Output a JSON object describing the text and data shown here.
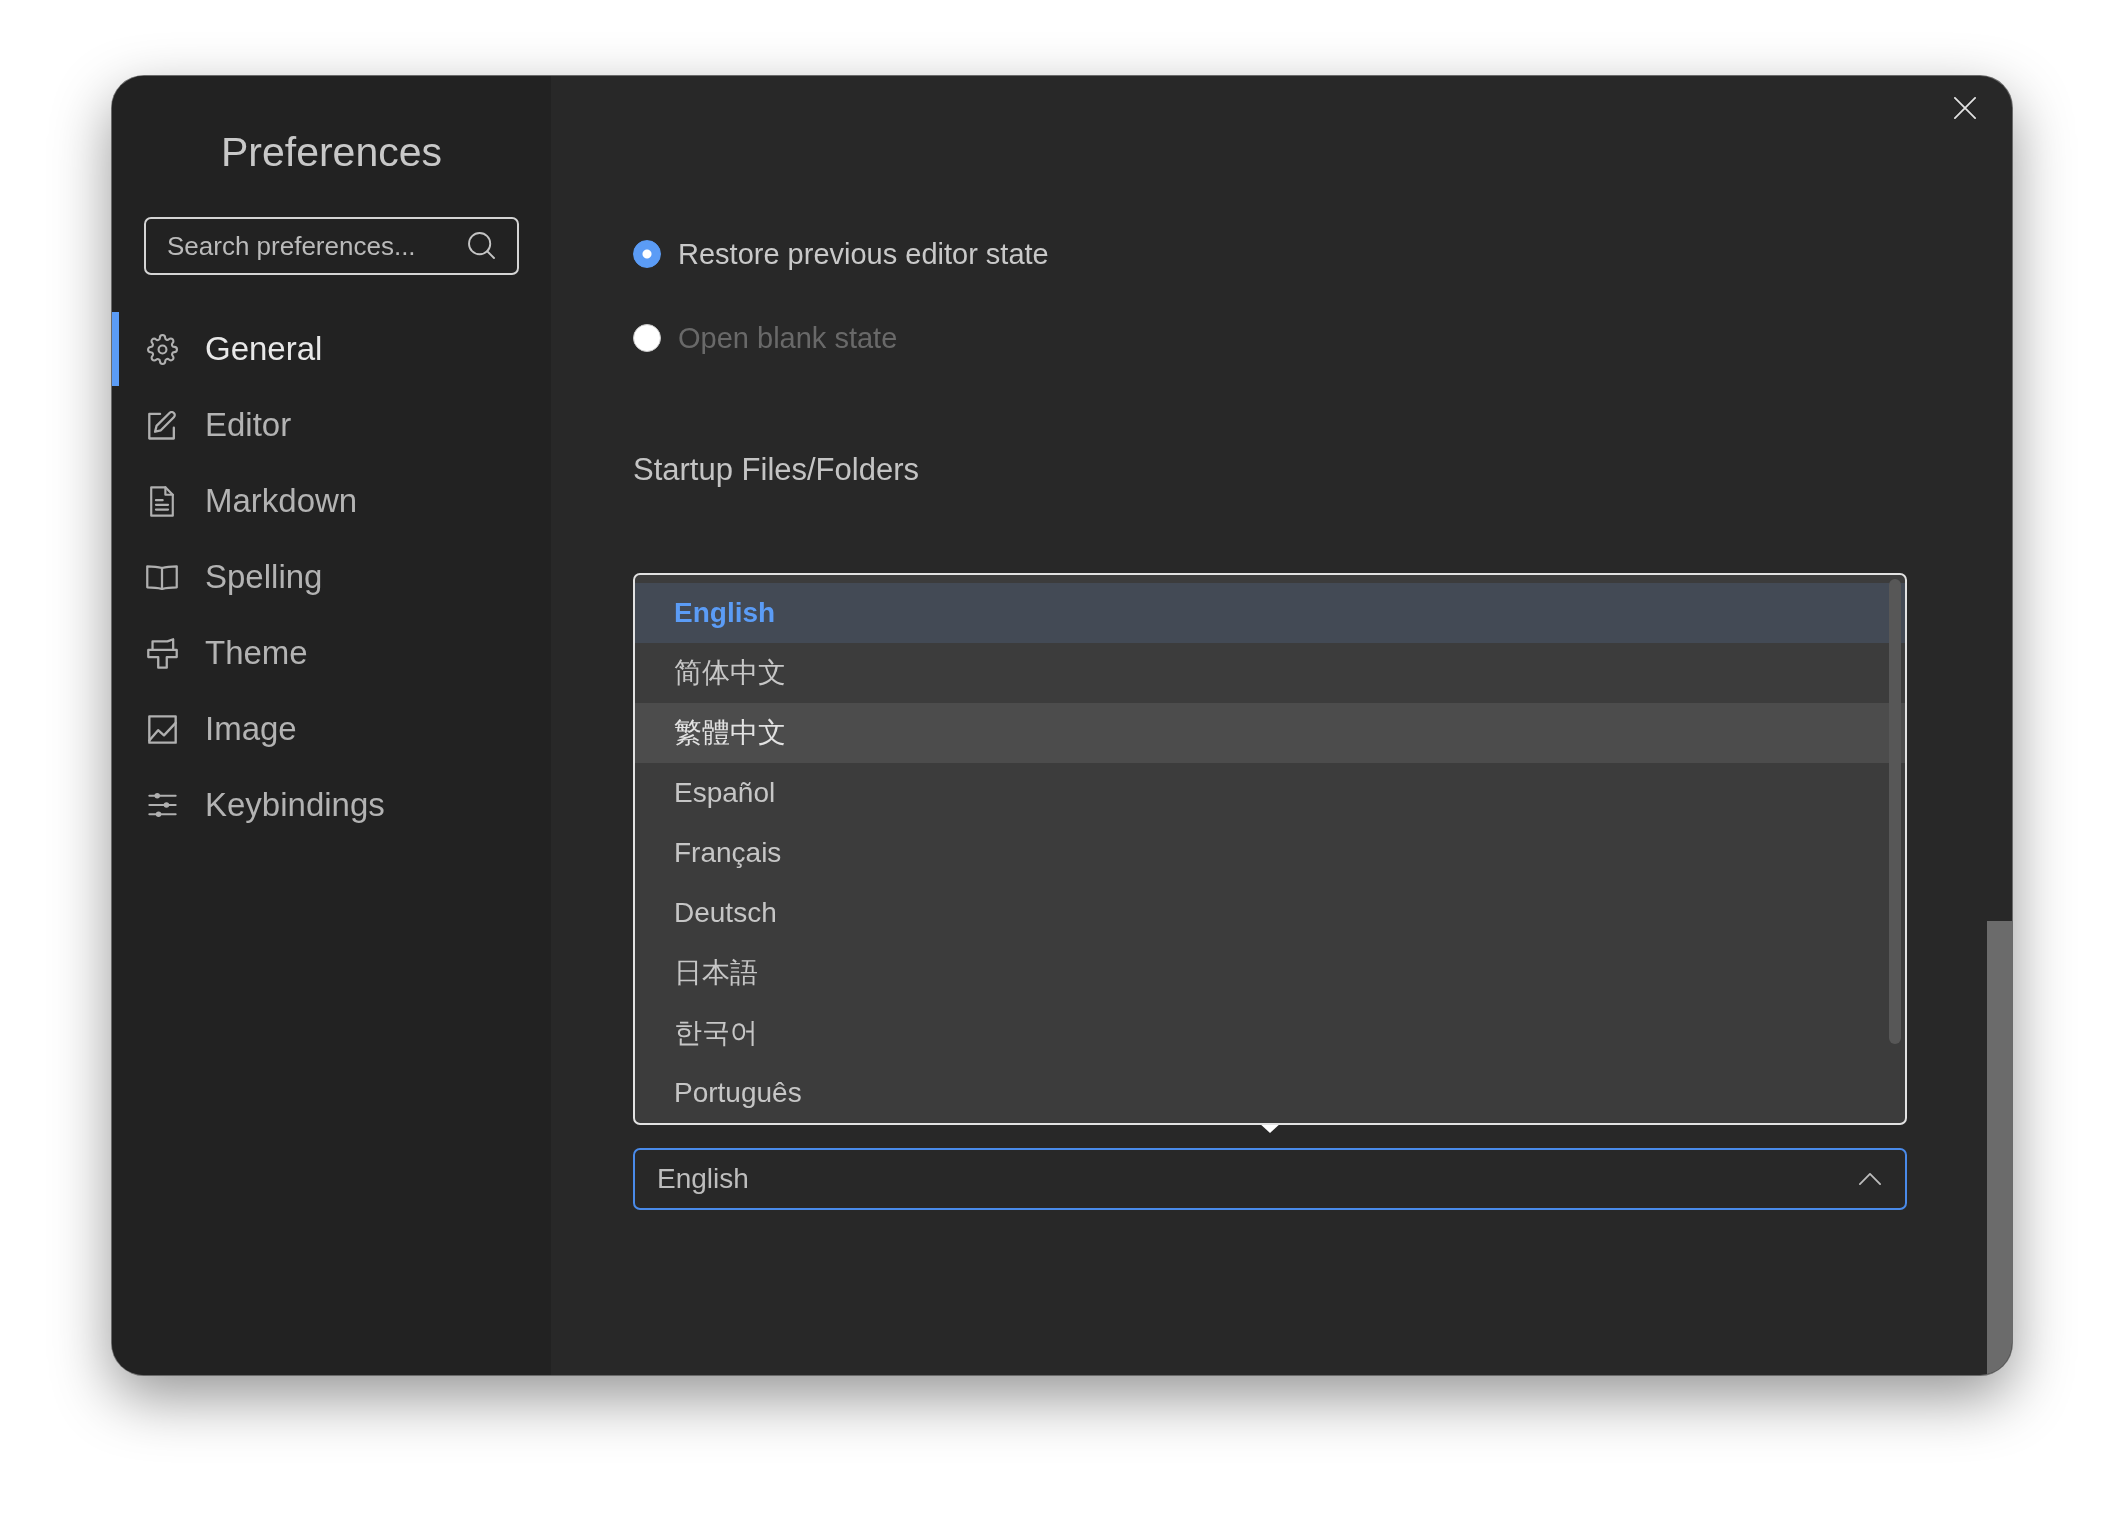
{
  "sidebar": {
    "title": "Preferences",
    "search": {
      "placeholder": "Search preferences..."
    },
    "items": [
      {
        "label": "General",
        "selected": true
      },
      {
        "label": "Editor",
        "selected": false
      },
      {
        "label": "Markdown",
        "selected": false
      },
      {
        "label": "Spelling",
        "selected": false
      },
      {
        "label": "Theme",
        "selected": false
      },
      {
        "label": "Image",
        "selected": false
      },
      {
        "label": "Keybindings",
        "selected": false
      }
    ]
  },
  "startup": {
    "options": [
      {
        "label": "Restore previous editor state",
        "selected": true
      },
      {
        "label": "Open blank state",
        "selected": false
      }
    ]
  },
  "startup_files": {
    "title": "Startup Files/Folders"
  },
  "language": {
    "expanded": true,
    "options": [
      {
        "label": "English",
        "selected": true,
        "hovered": false
      },
      {
        "label": "简体中文",
        "selected": false,
        "hovered": false
      },
      {
        "label": "繁體中文",
        "selected": false,
        "hovered": true
      },
      {
        "label": "Español",
        "selected": false,
        "hovered": false
      },
      {
        "label": "Français",
        "selected": false,
        "hovered": false
      },
      {
        "label": "Deutsch",
        "selected": false,
        "hovered": false
      },
      {
        "label": "日本語",
        "selected": false,
        "hovered": false
      },
      {
        "label": "한국어",
        "selected": false,
        "hovered": false
      },
      {
        "label": "Português",
        "selected": false,
        "hovered": false
      }
    ],
    "value": "English"
  }
}
